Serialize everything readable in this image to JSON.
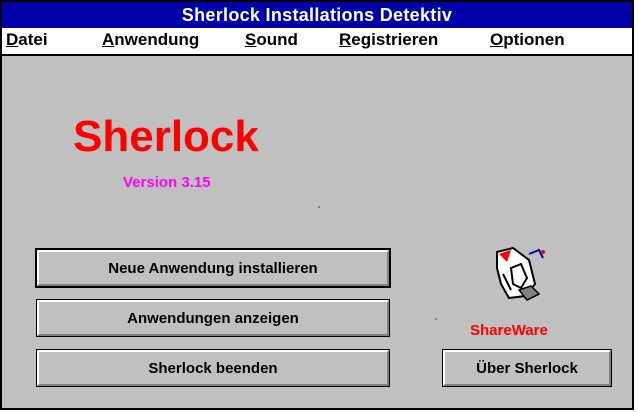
{
  "window": {
    "title": "Sherlock Installations Detektiv"
  },
  "menu": [
    {
      "first": "D",
      "rest": "atei"
    },
    {
      "first": "A",
      "rest": "nwendung"
    },
    {
      "first": "S",
      "rest": "ound"
    },
    {
      "first": "R",
      "rest": "egistrieren"
    },
    {
      "first": "O",
      "rest": "ptionen"
    }
  ],
  "main": {
    "app_name": "Sherlock",
    "version": "Version 3.15",
    "shareware": "ShareWare",
    "icon": "sherlock-app-icon",
    "buttons": {
      "install": "Neue Anwendung installieren",
      "show": "Anwendungen anzeigen",
      "quit": "Sherlock beenden",
      "about": "Über Sherlock"
    }
  },
  "colors": {
    "title_bar": "#0000a8",
    "app_name": "#ff0000",
    "version": "#ff00ff",
    "shareware": "#ff0000",
    "face": "#c0c0c0"
  }
}
